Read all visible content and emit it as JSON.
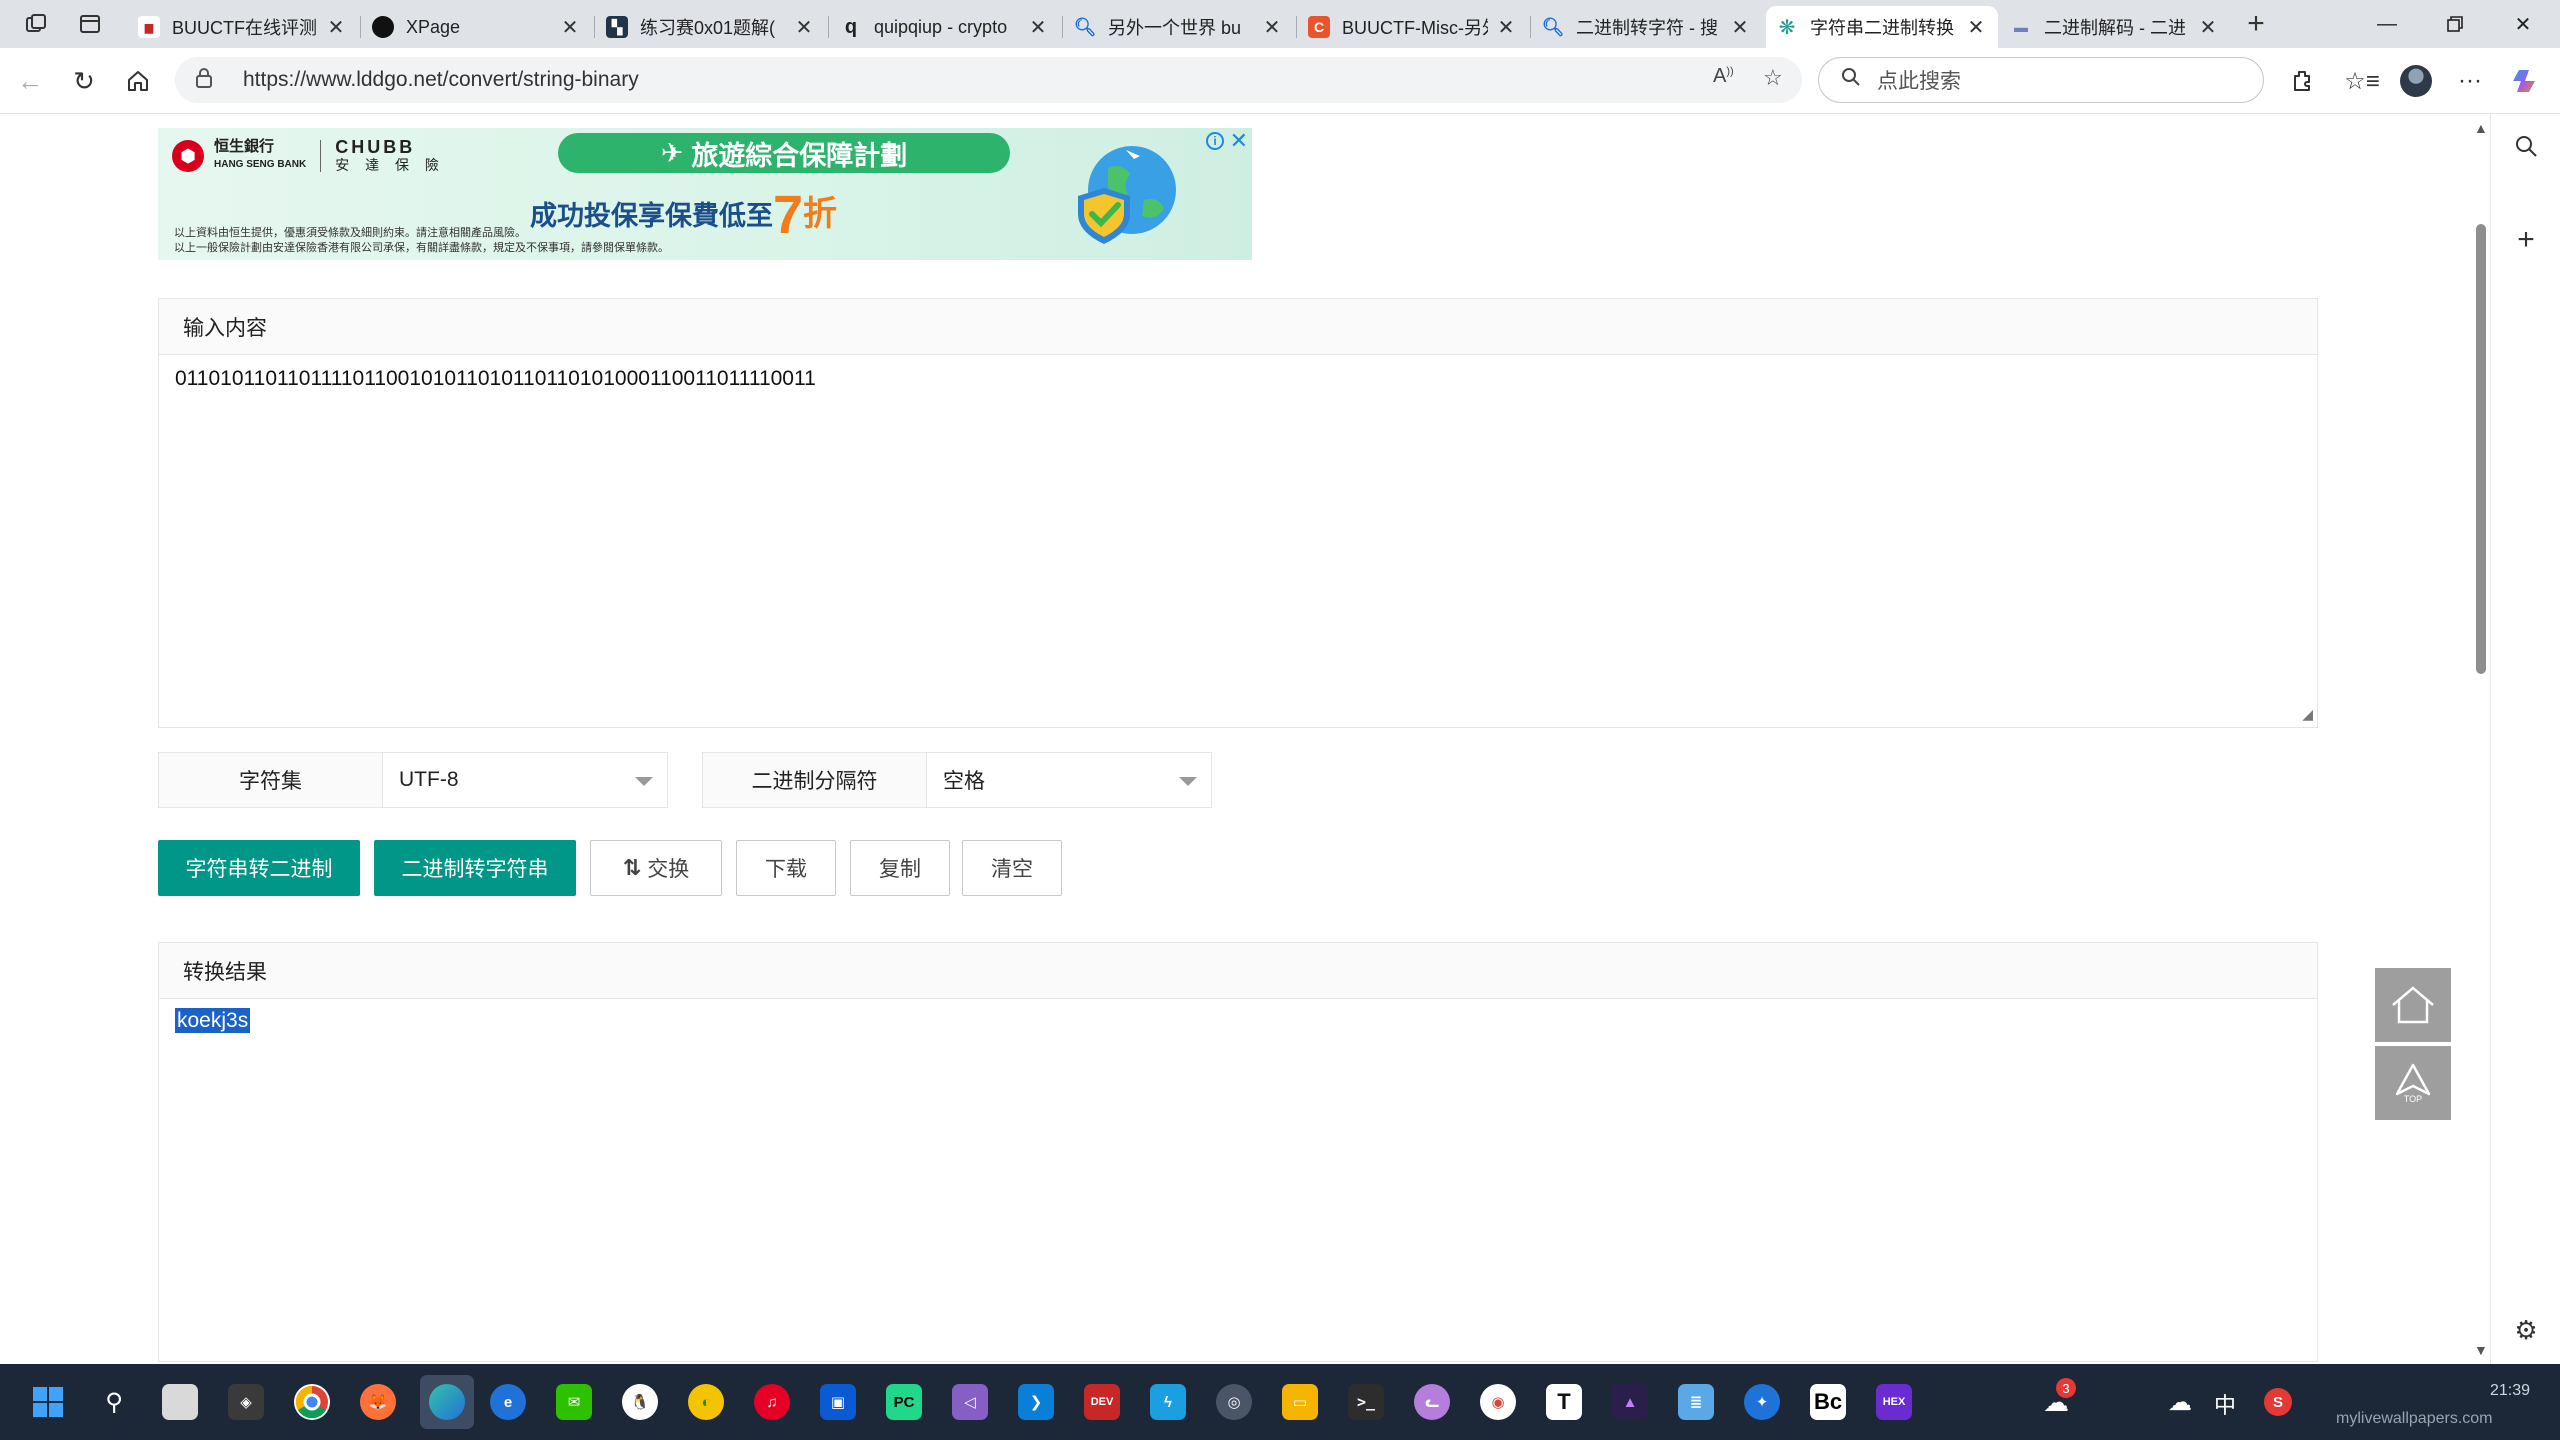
{
  "browser": {
    "tabs": [
      {
        "title": "BUUCTF在线评测",
        "favicon": "buuctf-icon",
        "color": "#c62828",
        "active": false
      },
      {
        "title": "XPage",
        "favicon": "xpage-icon",
        "color": "#111111",
        "active": false
      },
      {
        "title": "练习赛0x01题解(",
        "favicon": "practice-icon",
        "color": "#22344a",
        "active": false
      },
      {
        "title": "quipqiup - crypto",
        "favicon": "quipqiup-icon",
        "color": "#ffffff",
        "active": false
      },
      {
        "title": "另外一个世界 bu",
        "favicon": "search-icon",
        "color": "#1e6fd9",
        "active": false
      },
      {
        "title": "BUUCTF-Misc-另外",
        "favicon": "csdn-icon",
        "color": "#e8552d",
        "active": false
      },
      {
        "title": "二进制转字符 - 搜",
        "favicon": "search-icon",
        "color": "#1e6fd9",
        "active": false
      },
      {
        "title": "字符串二进制转换",
        "favicon": "lddgo-icon",
        "color": "#1a9e8f",
        "active": true
      },
      {
        "title": "二进制解码 - 二进",
        "favicon": "binary-icon",
        "color": "#6f7fbf",
        "active": false
      }
    ],
    "url": "https://www.lddgo.net/convert/string-binary",
    "search_placeholder": "点此搜索"
  },
  "ad": {
    "bank_name": "恒生銀行",
    "bank_name_en": "HANG SENG BANK",
    "insurer": "CHUBB",
    "insurer_cn": "安 達 保 險",
    "banner_title": "旅遊綜合保障計劃",
    "headline": "成功投保享保費低至",
    "discount_number": "7",
    "discount_unit": "折",
    "fine_print_1": "以上資料由恒生提供，優惠須受條款及細則約束。請注意相關產品風險。",
    "fine_print_2": "以上一般保險計劃由安達保險香港有限公司承保，有關詳盡條款，規定及不保事項，請參閱保單條款。"
  },
  "converter": {
    "input_title": "输入内容",
    "input_value": "011010110110111101100101011010110110101000110011011110011",
    "charset_label": "字符集",
    "charset_value": "UTF-8",
    "separator_label": "二进制分隔符",
    "separator_value": "空格",
    "buttons": {
      "to_binary": "字符串转二进制",
      "to_string": "二进制转字符串",
      "swap": "交换",
      "download": "下载",
      "copy": "复制",
      "clear": "清空"
    },
    "output_title": "转换结果",
    "output_value": "koekj3s"
  },
  "floating": {
    "home": "home-icon",
    "top_label": "TOP"
  },
  "taskbar": {
    "ime": "中",
    "notification_count": "3",
    "watermark": "mylivewallpapers.com",
    "clock": "21:39"
  },
  "colors": {
    "primary": "#009688",
    "selection": "#1a62c7",
    "taskbar": "#1c2738"
  }
}
